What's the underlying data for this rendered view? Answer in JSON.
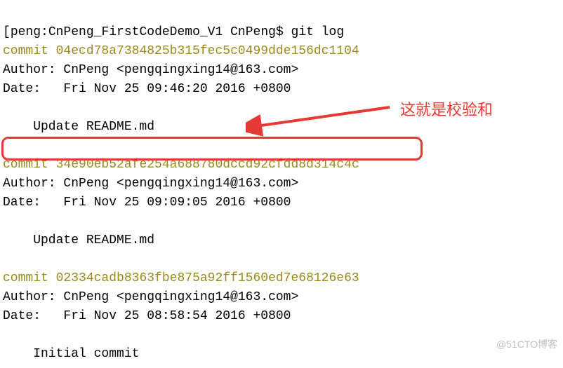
{
  "prompt": {
    "bracket": "[",
    "host": "peng",
    "sep": ":",
    "cwd": "CnPeng_FirstCodeDemo_V1",
    "user": "CnPeng",
    "dollar": "$",
    "command": "git log"
  },
  "commits": [
    {
      "hash": "04ecd78a7384825b315fec5c0499dde156dc1104",
      "author": "CnPeng <pengqingxing14@163.com>",
      "date": "Fri Nov 25 09:46:20 2016 +0800",
      "message": "Update README.md"
    },
    {
      "hash": "34e90eb52afe254a688780dccd92cfdd8d314c4c",
      "author": "CnPeng <pengqingxing14@163.com>",
      "date": "Fri Nov 25 09:09:05 2016 +0800",
      "message": "Update README.md"
    },
    {
      "hash": "02334cadb8363fbe875a92ff1560ed7e68126e63",
      "author": "CnPeng <pengqingxing14@163.com>",
      "date": "Fri Nov 25 08:58:54 2016 +0800",
      "message": "Initial commit"
    }
  ],
  "labels": {
    "commit_prefix": "commit ",
    "author_prefix": "Author: ",
    "date_prefix": "Date:   "
  },
  "annotation": {
    "text": "这就是校验和"
  },
  "watermark": {
    "text": "@51CTO博客"
  }
}
